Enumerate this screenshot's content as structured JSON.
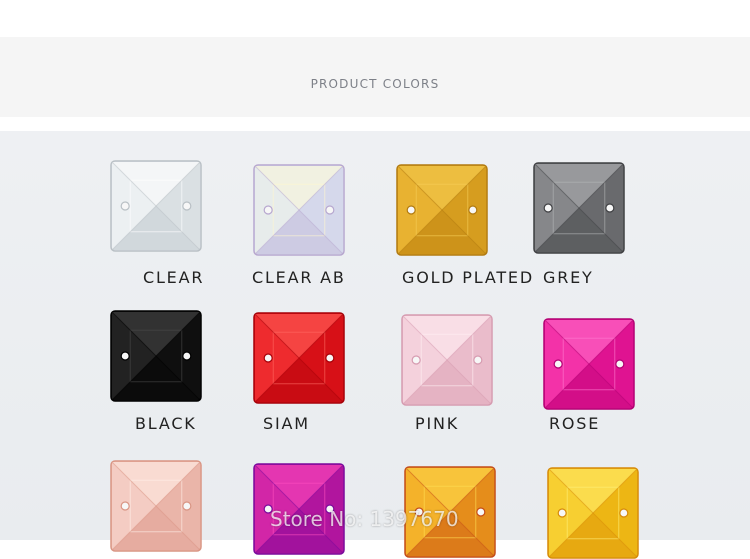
{
  "header": {
    "title": "PRODUCT COLORS"
  },
  "swatches": [
    {
      "label": "CLEAR",
      "color": "#e6ebee",
      "shade": "#b9c0c5",
      "light": "#ffffff"
    },
    {
      "label": "CLEAR AB",
      "color": "#dfe9f5",
      "shade": "#b7a7cf",
      "light": "#fff7cf"
    },
    {
      "label": "GOLD PLATED",
      "color": "#e3a824",
      "shade": "#b17a10",
      "light": "#f6cf58"
    },
    {
      "label": "GREY",
      "color": "#77787b",
      "shade": "#3f4043",
      "light": "#b4b5b8"
    },
    {
      "label": "BLACK",
      "color": "#141414",
      "shade": "#000000",
      "light": "#4a4a4a"
    },
    {
      "label": "SIAM",
      "color": "#e8161c",
      "shade": "#a50008",
      "light": "#ff6b62"
    },
    {
      "label": "PINK",
      "color": "#f1c7d4",
      "shade": "#d69bb0",
      "light": "#fff0f4"
    },
    {
      "label": "ROSE",
      "color": "#ef1a9b",
      "shade": "#b10072",
      "light": "#ff7bd0"
    },
    {
      "label": "",
      "color": "#f1c0b6",
      "shade": "#d99584",
      "light": "#fff0ea"
    },
    {
      "label": "",
      "color": "#c3199f",
      "shade": "#7a0a9c",
      "light": "#ff4ec0"
    },
    {
      "label": "",
      "color": "#f0a31d",
      "shade": "#c44c18",
      "light": "#ffe053"
    },
    {
      "label": "",
      "color": "#f5c418",
      "shade": "#d68a08",
      "light": "#fff07a"
    }
  ],
  "watermark": {
    "text": "Store No: 1397670"
  }
}
